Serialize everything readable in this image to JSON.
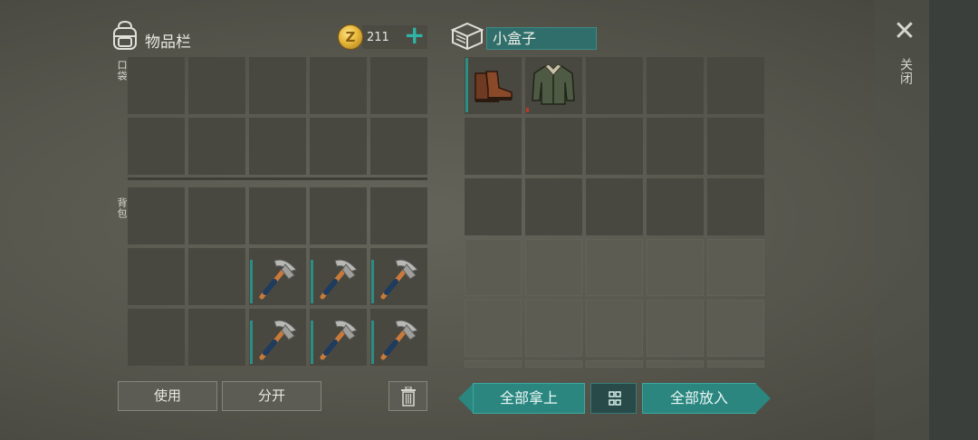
{
  "inventory": {
    "title": "物品栏",
    "coins": "211",
    "coin_symbol": "Z",
    "add_label": "+",
    "pocket_label": "口袋",
    "backpack_label": "背包"
  },
  "container": {
    "name": "小盒子",
    "items": [
      "boots",
      "jacket"
    ]
  },
  "backpack_items": [
    {
      "row": 1,
      "col": 2,
      "item": "pickaxe"
    },
    {
      "row": 1,
      "col": 3,
      "item": "pickaxe"
    },
    {
      "row": 1,
      "col": 4,
      "item": "pickaxe"
    },
    {
      "row": 2,
      "col": 2,
      "item": "pickaxe"
    },
    {
      "row": 2,
      "col": 3,
      "item": "pickaxe"
    },
    {
      "row": 2,
      "col": 4,
      "item": "pickaxe"
    }
  ],
  "close": {
    "icon": "close-icon",
    "label": "关闭"
  },
  "buttons": {
    "use": "使用",
    "split": "分开",
    "take_all": "全部拿上",
    "put_all": "全部放入"
  },
  "colors": {
    "accent": "#2b8680",
    "durability": "#2a8e86",
    "durability_low": "#b83a2a"
  }
}
